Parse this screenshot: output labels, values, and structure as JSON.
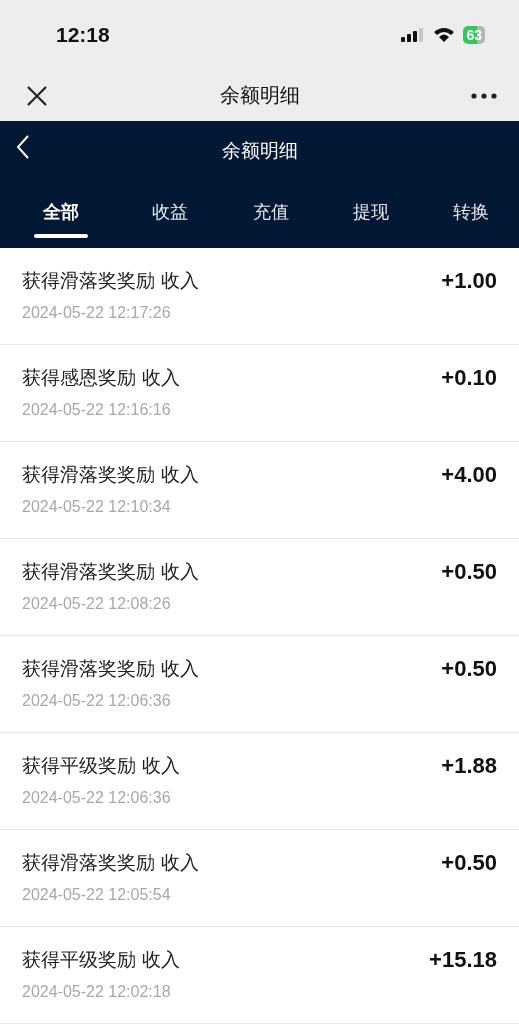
{
  "status_bar": {
    "time": "12:18",
    "battery": "63"
  },
  "nav_bar": {
    "title": "余额明细"
  },
  "header": {
    "title": "余额明细"
  },
  "tabs": [
    {
      "label": "全部",
      "selected": true
    },
    {
      "label": "收益",
      "selected": false
    },
    {
      "label": "充值",
      "selected": false
    },
    {
      "label": "提现",
      "selected": false
    },
    {
      "label": "转换",
      "selected": false
    }
  ],
  "records": [
    {
      "title": "获得滑落奖奖励 收入",
      "time": "2024-05-22 12:17:26",
      "amount": "+1.00"
    },
    {
      "title": "获得感恩奖励 收入",
      "time": "2024-05-22 12:16:16",
      "amount": "+0.10"
    },
    {
      "title": "获得滑落奖奖励 收入",
      "time": "2024-05-22 12:10:34",
      "amount": "+4.00"
    },
    {
      "title": "获得滑落奖奖励 收入",
      "time": "2024-05-22 12:08:26",
      "amount": "+0.50"
    },
    {
      "title": "获得滑落奖奖励 收入",
      "time": "2024-05-22 12:06:36",
      "amount": "+0.50"
    },
    {
      "title": "获得平级奖励 收入",
      "time": "2024-05-22 12:06:36",
      "amount": "+1.88"
    },
    {
      "title": "获得滑落奖奖励 收入",
      "time": "2024-05-22 12:05:54",
      "amount": "+0.50"
    },
    {
      "title": "获得平级奖励 收入",
      "time": "2024-05-22 12:02:18",
      "amount": "+15.18"
    }
  ]
}
